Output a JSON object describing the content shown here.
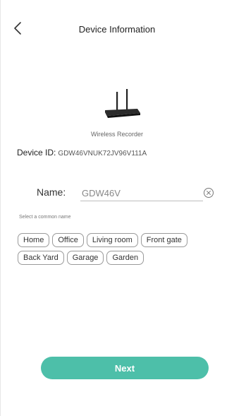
{
  "header": {
    "title": "Device Information",
    "back_icon": "chevron-left-icon"
  },
  "device": {
    "image_icon": "wireless-recorder-icon",
    "model_label": "Wireless Recorder",
    "id_key": "Device ID:",
    "id_value": "GDW46VNUK72JV96V111A"
  },
  "name_field": {
    "label": "Name:",
    "value": "GDW46V",
    "clear_icon": "clear-circle-icon"
  },
  "suggestions": {
    "hint": "Select a common name",
    "rows": [
      [
        "Home",
        "Office",
        "Living room",
        "Front gate"
      ],
      [
        "Back Yard",
        "Garage",
        "Garden"
      ]
    ]
  },
  "actions": {
    "next_label": "Next"
  },
  "colors": {
    "accent": "#4dbfa9"
  }
}
